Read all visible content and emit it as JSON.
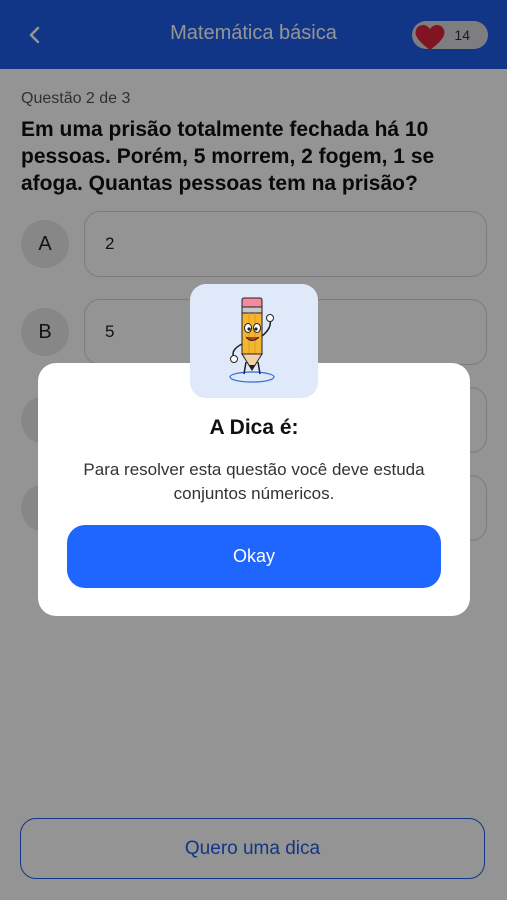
{
  "header": {
    "title": "Matemática básica",
    "lives_count": "14",
    "color": "#1f5ee8"
  },
  "question": {
    "counter": "Questão 2 de 3",
    "text": "Em uma prisão totalmente fechada há 10 pessoas. Porém, 5 morrem, 2 fogem, 1 se afoga. Quantas pessoas tem na prisão?"
  },
  "options": [
    {
      "letter": "A",
      "value": "2"
    },
    {
      "letter": "B",
      "value": "5"
    },
    {
      "letter": "",
      "value": ""
    },
    {
      "letter": "",
      "value": ""
    }
  ],
  "hint_button": "Quero uma dica",
  "modal": {
    "title": "A Dica é:",
    "text": "Para resolver esta questão você deve estuda conjuntos númericos.",
    "button": "Okay"
  },
  "icons": {
    "back": "chevron-left-icon",
    "lives": "heart-icon",
    "illustration": "pencil-mascot-icon"
  }
}
